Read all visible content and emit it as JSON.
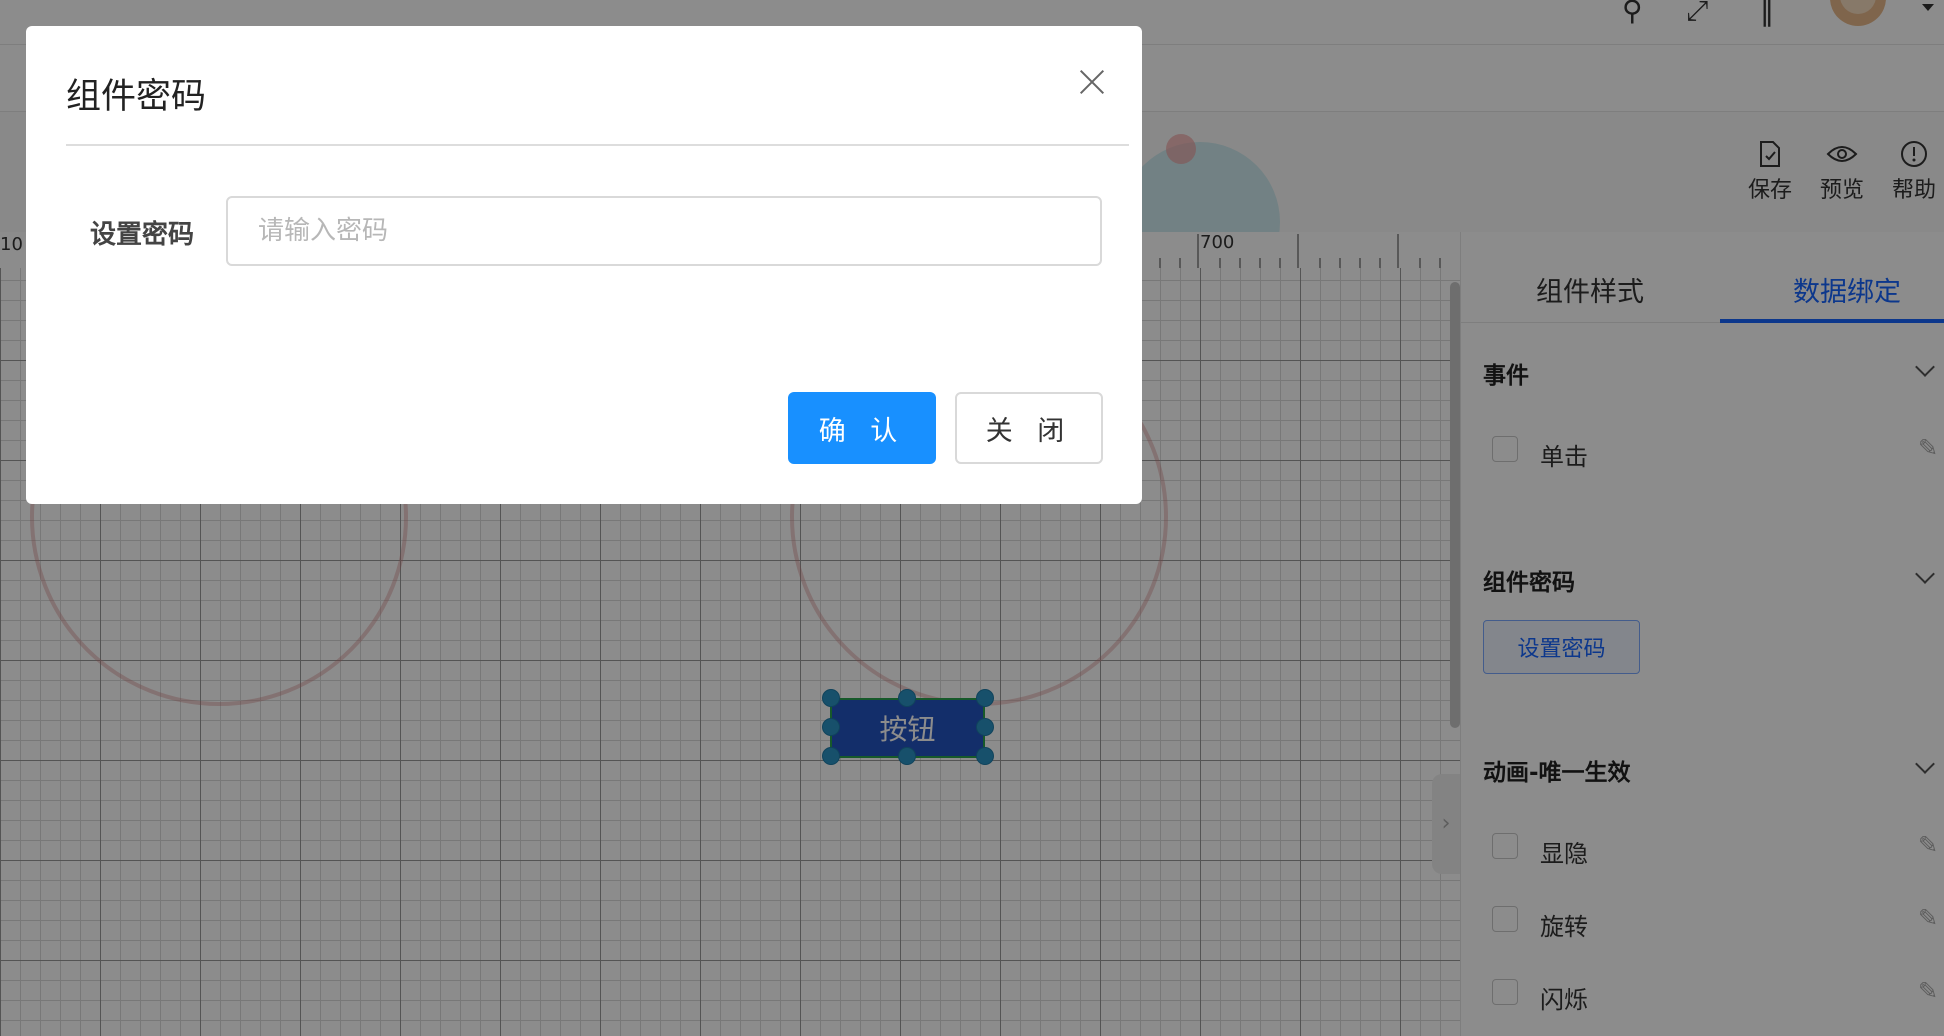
{
  "modal": {
    "title": "组件密码",
    "form_label": "设置密码",
    "password_placeholder": "请输入密码",
    "confirm_label": "确 认",
    "close_label": "关 闭"
  },
  "toolbar": {
    "items": [
      {
        "label": "保存",
        "icon": "save-file-icon"
      },
      {
        "label": "预览",
        "icon": "eye-icon"
      },
      {
        "label": "帮助",
        "icon": "info-icon"
      }
    ]
  },
  "ruler": {
    "label_700": "700",
    "label_left": "10"
  },
  "canvas": {
    "button_label": "按钮"
  },
  "panel": {
    "tabs": [
      {
        "label": "组件样式",
        "active": false
      },
      {
        "label": "数据绑定",
        "active": true
      }
    ],
    "sections": {
      "events": {
        "title": "事件",
        "items": [
          "单击"
        ]
      },
      "password": {
        "title": "组件密码",
        "button_label": "设置密码"
      },
      "animation": {
        "title": "动画-唯一生效",
        "items": [
          "显隐",
          "旋转",
          "闪烁"
        ]
      }
    }
  },
  "colors": {
    "primary": "#1890ff",
    "active_tab": "#1664ff",
    "canvas_button": "#2454c2",
    "handle": "#2b93c4"
  }
}
